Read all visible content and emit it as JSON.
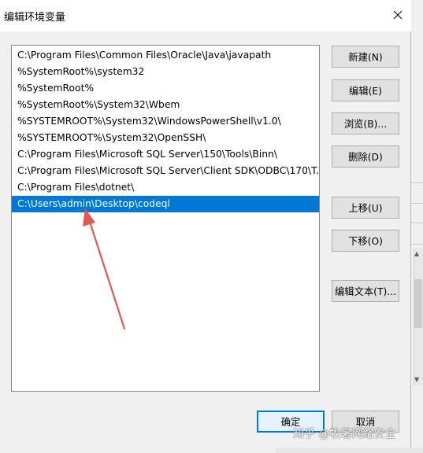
{
  "window": {
    "title": "编辑环境变量"
  },
  "path_list": {
    "items": [
      "C:\\Program Files\\Common Files\\Oracle\\Java\\javapath",
      "%SystemRoot%\\system32",
      "%SystemRoot%",
      "%SystemRoot%\\System32\\Wbem",
      "%SYSTEMROOT%\\System32\\WindowsPowerShell\\v1.0\\",
      "%SYSTEMROOT%\\System32\\OpenSSH\\",
      "C:\\Program Files\\Microsoft SQL Server\\150\\Tools\\Binn\\",
      "C:\\Program Files\\Microsoft SQL Server\\Client SDK\\ODBC\\170\\T...",
      "C:\\Program Files\\dotnet\\",
      "C:\\Users\\admin\\Desktop\\codeql"
    ],
    "selected_index": 9
  },
  "buttons": {
    "new": "新建(N)",
    "edit": "编辑(E)",
    "browse": "浏览(B)...",
    "delete": "删除(D)",
    "move_up": "上移(U)",
    "move_down": "下移(O)",
    "edit_text": "编辑文本(T)...",
    "ok": "确定",
    "cancel": "取消"
  },
  "watermark": "知乎 @牧暑网络安全",
  "colors": {
    "selection": "#0078d7",
    "annotation_arrow": "#e05a4f"
  }
}
